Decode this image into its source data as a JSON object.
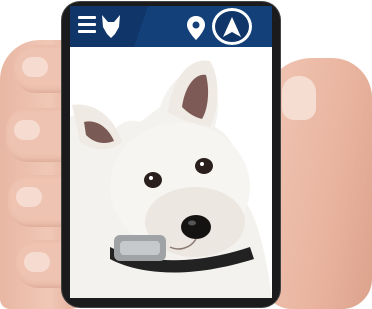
{
  "app": {
    "topbar": {
      "menu_icon": "hamburger-menu-icon",
      "logo_icon": "dog-head-logo-icon",
      "location_icon": "map-pin-icon",
      "compass_icon": "compass-arrow-icon"
    },
    "photo": {
      "subject_icon": "dog-with-collar-image"
    }
  },
  "colors": {
    "topbar": "#14407a",
    "topbar_dark": "#0f3569",
    "icon": "#ffffff"
  }
}
